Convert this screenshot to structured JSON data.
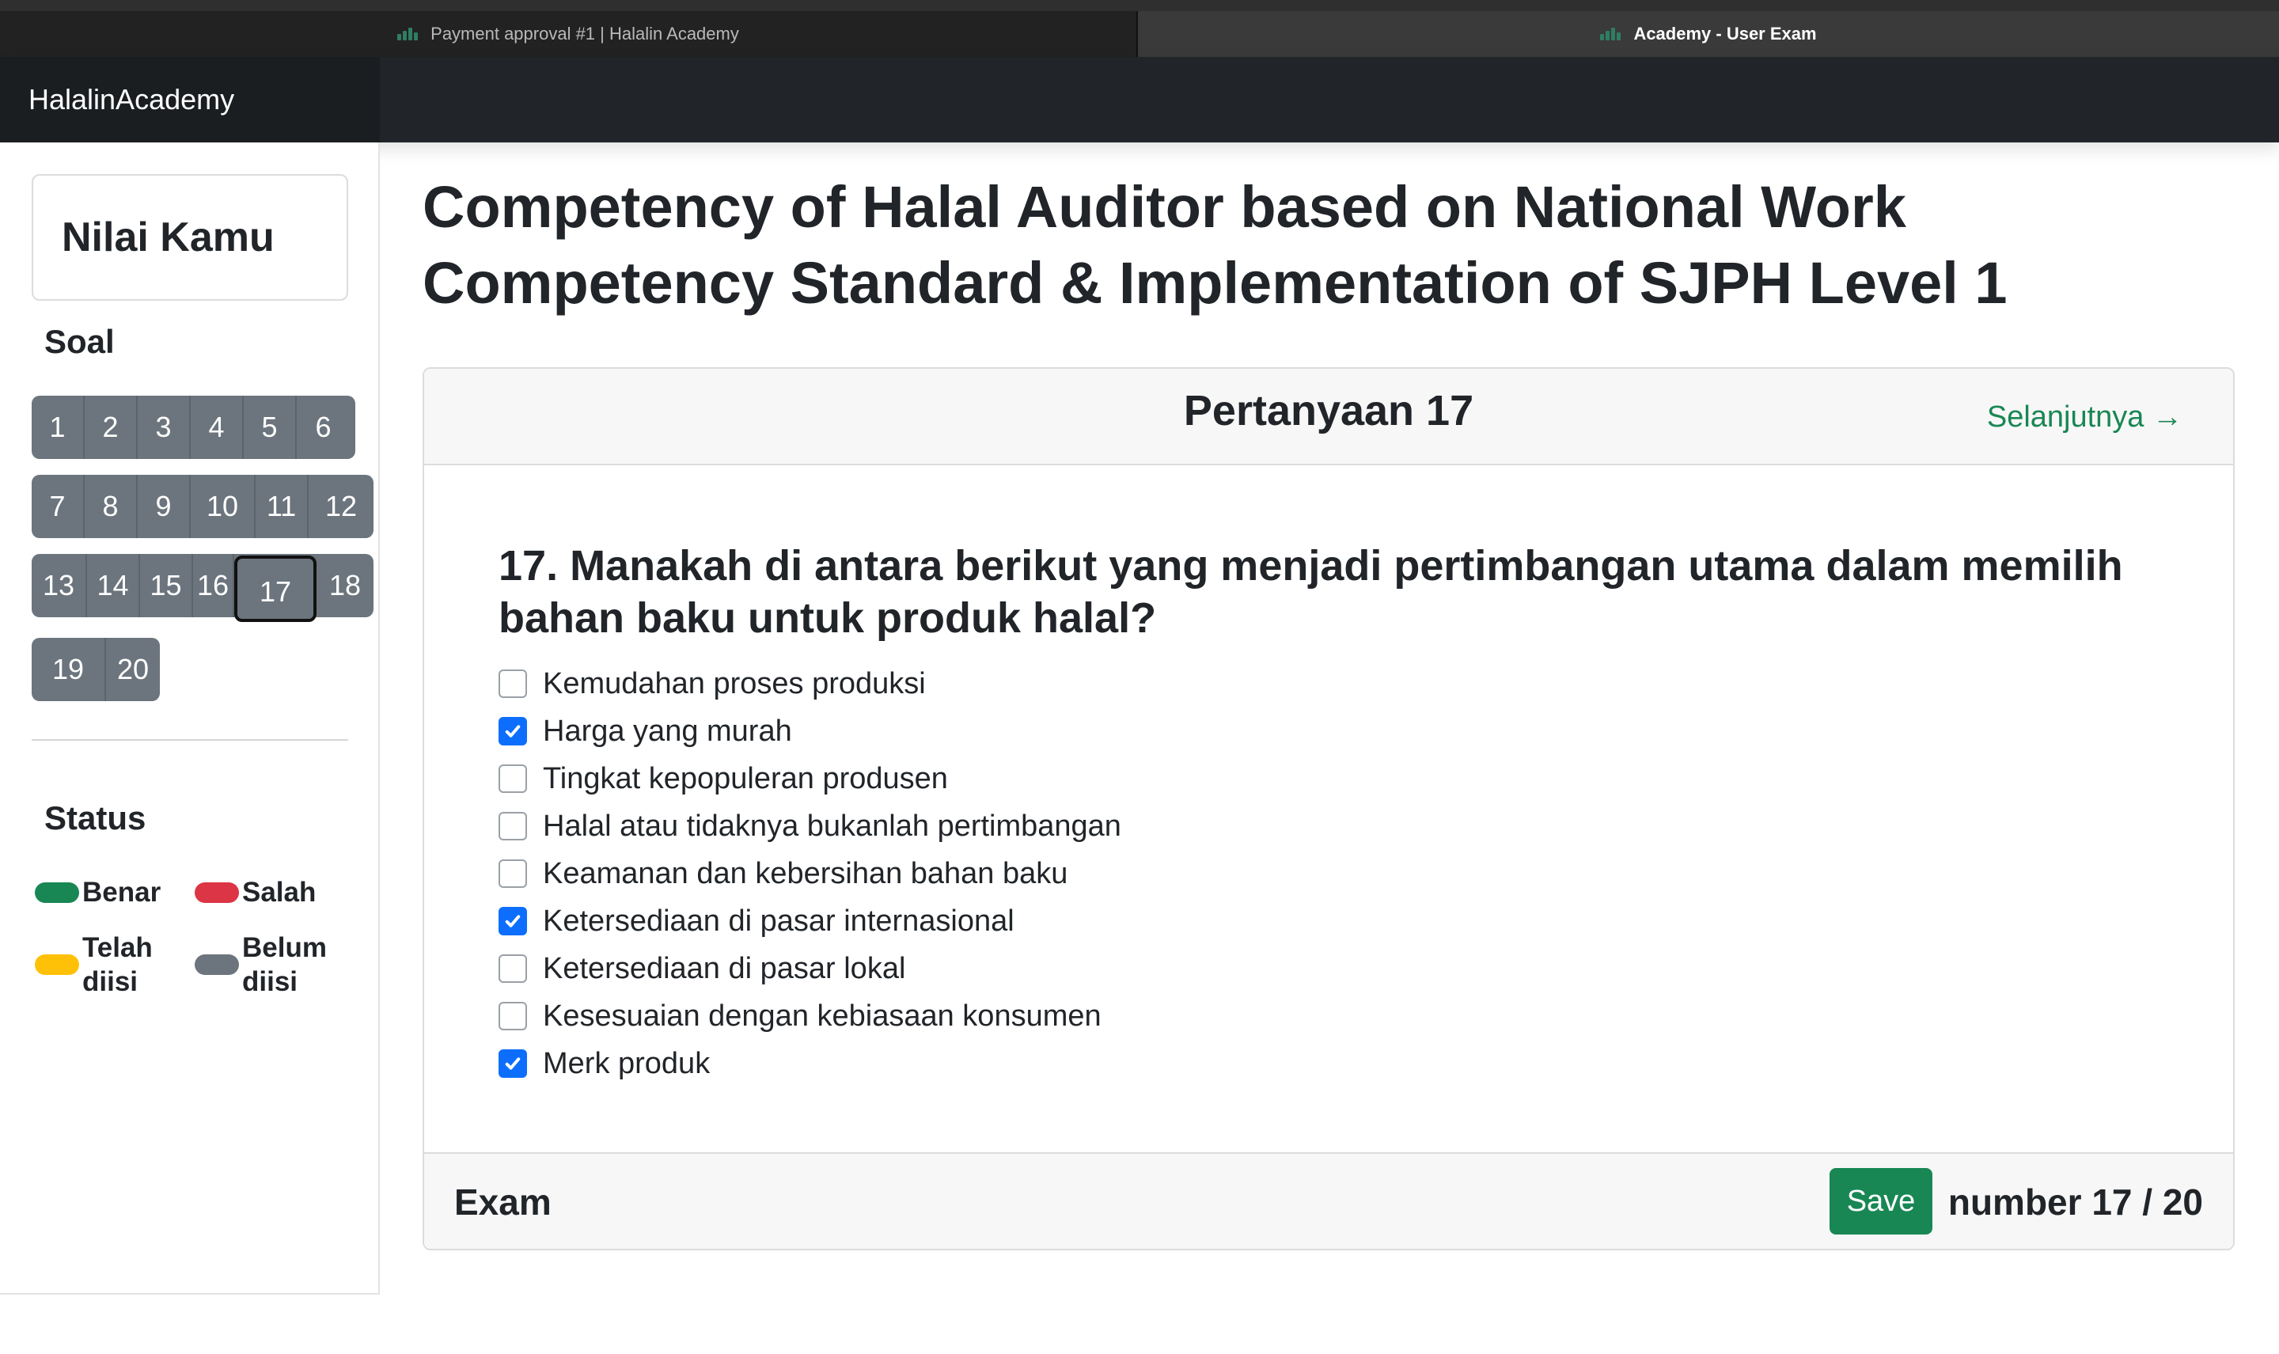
{
  "browser": {
    "tabs": [
      {
        "title": "Payment approval #1 | Halalin Academy",
        "active": false
      },
      {
        "title": "Academy - User Exam",
        "active": true
      }
    ]
  },
  "navbar": {
    "brand": "HalalinAcademy"
  },
  "sidebar": {
    "score_title": "Nilai Kamu",
    "questions_title": "Soal",
    "question_rows": [
      [
        "1",
        "2",
        "3",
        "4",
        "5",
        "6"
      ],
      [
        "7",
        "8",
        "9",
        "10",
        "11",
        "12"
      ],
      [
        "13",
        "14",
        "15",
        "16",
        "17",
        "18"
      ],
      [
        "19",
        "20"
      ]
    ],
    "current_question": "17",
    "status_title": "Status",
    "legend": [
      {
        "label": "Benar",
        "color": "#198754"
      },
      {
        "label": "Salah",
        "color": "#dc3545"
      },
      {
        "label": "Telah diisi",
        "line1": "Telah",
        "line2": "diisi",
        "color": "#ffc107"
      },
      {
        "label": "Belum diisi",
        "line1": "Belum",
        "line2": "diisi",
        "color": "#6c757d"
      }
    ]
  },
  "main": {
    "title": "Competency of Halal Auditor based on National Work Competency Standard & Implementation of SJPH Level 1",
    "card": {
      "header_title": "Pertanyaan 17",
      "next_label": "Selanjutnya →",
      "question": "17. Manakah di antara berikut yang menjadi pertimbangan utama dalam memilih bahan baku untuk produk halal?",
      "options": [
        {
          "label": "Kemudahan proses produksi",
          "checked": false
        },
        {
          "label": "Harga yang murah",
          "checked": true
        },
        {
          "label": "Tingkat kepopuleran produsen",
          "checked": false
        },
        {
          "label": "Halal atau tidaknya bukanlah pertimbangan",
          "checked": false
        },
        {
          "label": "Keamanan dan kebersihan bahan baku",
          "checked": false
        },
        {
          "label": "Ketersediaan di pasar internasional",
          "checked": true
        },
        {
          "label": "Ketersediaan di pasar lokal",
          "checked": false
        },
        {
          "label": "Kesesuaian dengan kebiasaan konsumen",
          "checked": false
        },
        {
          "label": "Merk produk",
          "checked": true
        }
      ],
      "footer_label": "Exam",
      "save_label": "Save",
      "counter": "number 17 / 20"
    }
  },
  "colors": {
    "accent_blue": "#0d6efd",
    "success_green": "#198754",
    "navbar_dark": "#212529",
    "question_button_gray": "#6c757d"
  }
}
